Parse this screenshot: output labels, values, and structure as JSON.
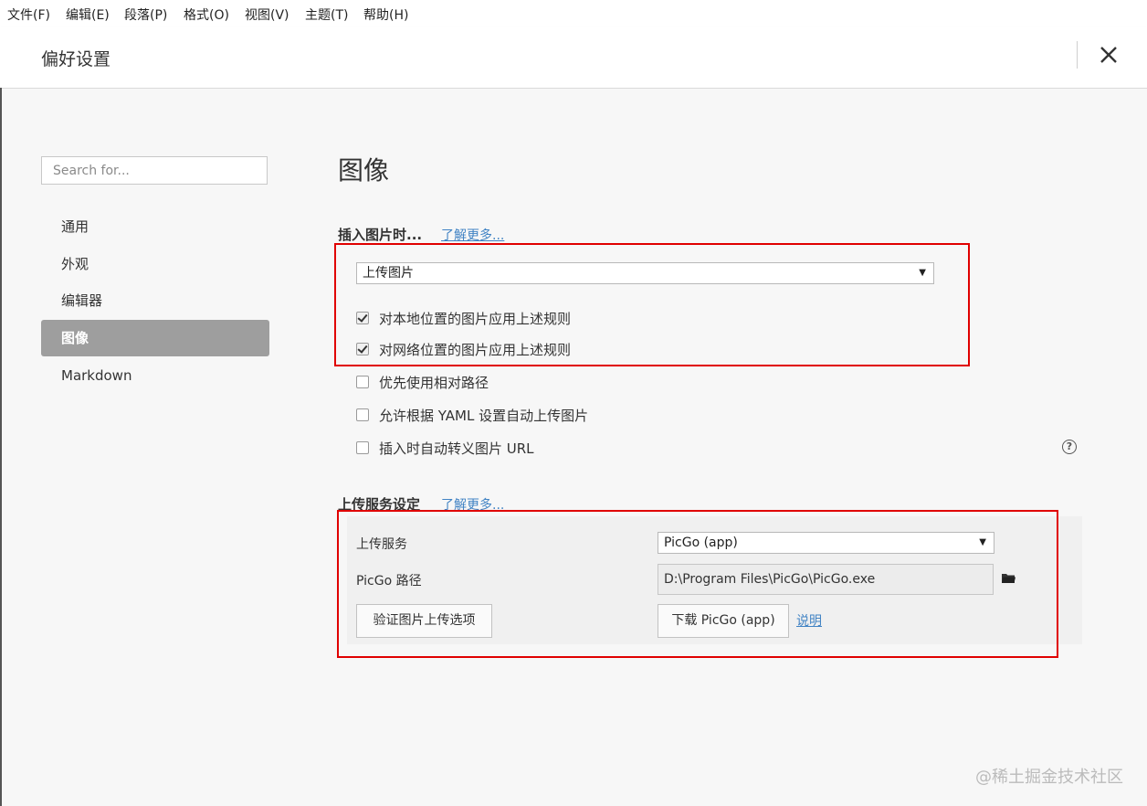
{
  "menubar": {
    "items": [
      "文件(F)",
      "编辑(E)",
      "段落(P)",
      "格式(O)",
      "视图(V)",
      "主题(T)",
      "帮助(H)"
    ]
  },
  "dialog": {
    "title": "偏好设置",
    "close_icon": "close-icon"
  },
  "sidebar": {
    "search_placeholder": "Search for...",
    "items": [
      {
        "label": "通用",
        "active": false
      },
      {
        "label": "外观",
        "active": false
      },
      {
        "label": "编辑器",
        "active": false
      },
      {
        "label": "图像",
        "active": true
      },
      {
        "label": "Markdown",
        "active": false
      }
    ]
  },
  "main": {
    "section_title": "图像",
    "insert_group": {
      "label": "插入图片时...",
      "learn_more": "了解更多...",
      "select_value": "上传图片",
      "options": [
        {
          "label": "对本地位置的图片应用上述规则",
          "checked": true
        },
        {
          "label": "对网络位置的图片应用上述规则",
          "checked": true
        },
        {
          "label": "优先使用相对路径",
          "checked": false
        },
        {
          "label": "允许根据 YAML 设置自动上传图片",
          "checked": false
        },
        {
          "label": "插入时自动转义图片 URL",
          "checked": false
        }
      ],
      "help_icon": "question-circle-icon",
      "help_glyph": "?"
    },
    "upload_group": {
      "label": "上传服务设定",
      "learn_more": "了解更多...",
      "service_label": "上传服务",
      "service_value": "PicGo (app)",
      "path_label": "PicGo 路径",
      "path_value": "D:\\Program Files\\PicGo\\PicGo.exe",
      "folder_icon": "folder-icon",
      "verify_button": "验证图片上传选项",
      "download_button": "下载 PicGo (app)",
      "explain_link": "说明"
    }
  },
  "watermark": "@稀土掘金技术社区",
  "colors": {
    "accent_link": "#4183c4",
    "active_nav_bg": "#9e9e9e",
    "highlight_border": "#e00000",
    "content_bg": "#f7f7f7"
  }
}
